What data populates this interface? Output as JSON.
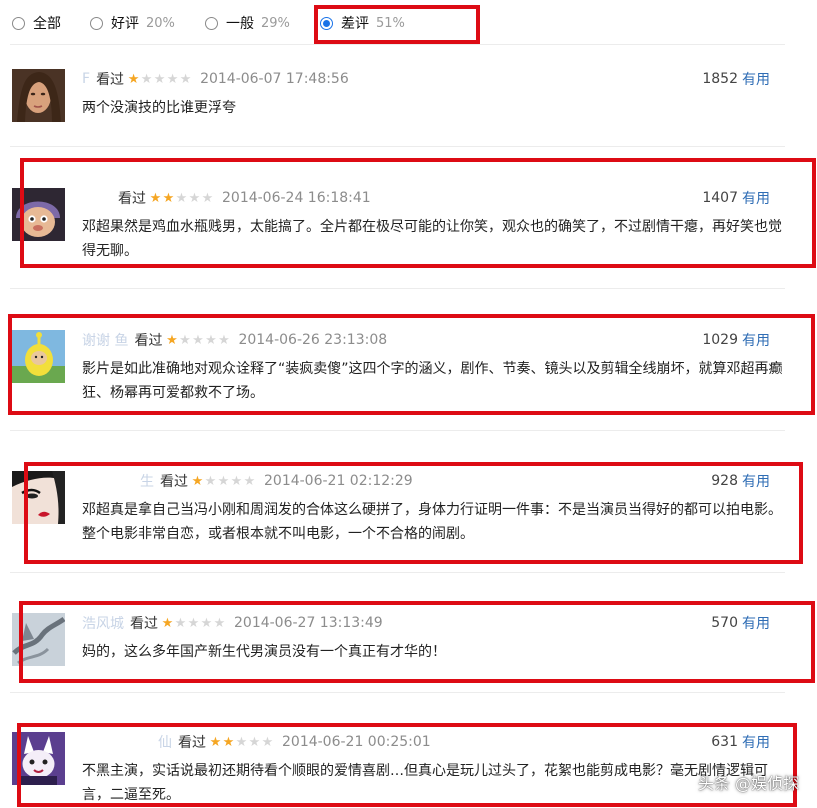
{
  "filters": [
    {
      "label": "全部",
      "pct": "",
      "checked": false
    },
    {
      "label": "好评",
      "pct": "20%",
      "checked": false
    },
    {
      "label": "一般",
      "pct": "29%",
      "checked": false
    },
    {
      "label": "差评",
      "pct": "51%",
      "checked": true
    }
  ],
  "reviews": [
    {
      "user": "F",
      "watched": "看过",
      "rating": 1,
      "time": "2014-06-07 17:48:56",
      "votes": "1852",
      "useful": "有用",
      "text": "两个没演技的比谁更浮夸"
    },
    {
      "user": "",
      "watched": "看过",
      "rating": 2,
      "time": "2014-06-24 16:18:41",
      "votes": "1407",
      "useful": "有用",
      "text": "邓超果然是鸡血水瓶贱男，太能搞了。全片都在极尽可能的让你笑，观众也的确笑了，不过剧情干瘪，再好笑也觉得无聊。"
    },
    {
      "user": "谢谢 鱼",
      "watched": "看过",
      "rating": 1,
      "time": "2014-06-26 23:13:08",
      "votes": "1029",
      "useful": "有用",
      "text": "影片是如此准确地对观众诠释了“装疯卖傻”这四个字的涵义，剧作、节奏、镜头以及剪辑全线崩坏，就算邓超再癫狂、杨幂再可爱都救不了场。"
    },
    {
      "user": "生",
      "watched": "看过",
      "rating": 1,
      "time": "2014-06-21 02:12:29",
      "votes": "928",
      "useful": "有用",
      "text": "邓超真是拿自己当冯小刚和周润发的合体这么硬拼了，身体力行证明一件事：不是当演员当得好的都可以拍电影。整个电影非常自恋，或者根本就不叫电影，一个不合格的闹剧。"
    },
    {
      "user": "浩风城",
      "watched": "看过",
      "rating": 1,
      "time": "2014-06-27 13:13:49",
      "votes": "570",
      "useful": "有用",
      "text": "妈的，这么多年国产新生代男演员没有一个真正有才华的！"
    },
    {
      "user": "仙",
      "watched": "看过",
      "rating": 2,
      "time": "2014-06-21 00:25:01",
      "votes": "631",
      "useful": "有用",
      "text": "不黑主演，实话说最初还期待看个顺眼的爱情喜剧…但真心是玩儿过头了，花絮也能剪成电影？毫无剧情逻辑可言，二逼至死。"
    }
  ],
  "watermark": "头条 @娱侦探",
  "colors": {
    "highlight": "#dd0b14",
    "link": "#2f6db5",
    "star": "#f5a623",
    "radio": "#1a73e8"
  }
}
